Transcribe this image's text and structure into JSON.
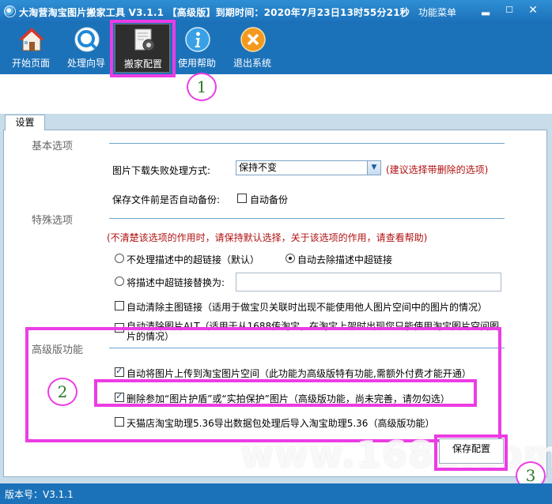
{
  "title_bar": {
    "title": "大淘营淘宝图片搬家工具 V3.1.1 【高级版】到期时间：2020年7月23日13时55分21秒",
    "func_menu": "功能菜单",
    "min": "▂",
    "max": "☐",
    "close": "✕"
  },
  "toolbar": {
    "items": [
      {
        "label": "开始页面",
        "icon": "home-icon"
      },
      {
        "label": "处理向导",
        "icon": "wizard-icon"
      },
      {
        "label": "搬家配置",
        "icon": "settings-doc-icon"
      },
      {
        "label": "使用帮助",
        "icon": "info-icon"
      },
      {
        "label": "退出系统",
        "icon": "exit-icon"
      }
    ]
  },
  "annotations": {
    "one": "1",
    "two": "2",
    "three": "3"
  },
  "tab": {
    "label": "设置"
  },
  "basic": {
    "title": "基本选项",
    "download_fail_label": "图片下载失败处理方式:",
    "download_fail_value": "保持不变",
    "download_fail_hint": "(建议选择带删除的选项)",
    "backup_label": "保存文件前是否自动备份:",
    "backup_checkbox": "自动备份"
  },
  "special": {
    "title": "特殊选项",
    "warning": "(不清楚该选项的作用时，请保持默认选择，关于该选项的作用，请查看帮助)",
    "radio_keep": "不处理描述中的超链接（默认）",
    "radio_remove": "自动去除描述中超链接",
    "radio_replace": "将描述中超链接替换为:",
    "replace_value": "",
    "cb_clear_main": "自动清除主图链接（适用于做宝贝关联时出现不能使用他人图片空间中的图片的情况）",
    "cb_clear_alt_1": "自动清除图片ALT（适用于从1688传淘宝，在淘宝上架时出现您只能使用淘宝图片空间图",
    "cb_clear_alt_2": "片的情况）"
  },
  "advanced": {
    "title": "高级版功能",
    "cb_upload": "自动将图片上传到淘宝图片空间（此功能为高级版特有功能,需额外付费才能开通）",
    "cb_delete_protect": "删除参加“图片护盾”或“实拍保护”图片（高级版功能，尚未完善，请勿勾选）",
    "cb_tmall": "天猫店淘宝助理5.36导出数据包处理后导入淘宝助理5.36（高级版功能）"
  },
  "watermark": "www.1688.com",
  "save_button": "保存配置",
  "status": {
    "version": "版本号：V3.1.1"
  },
  "colors": {
    "highlight": "#ec3ce4",
    "titlebar": "#1c72b9",
    "warning": "#b01010"
  }
}
